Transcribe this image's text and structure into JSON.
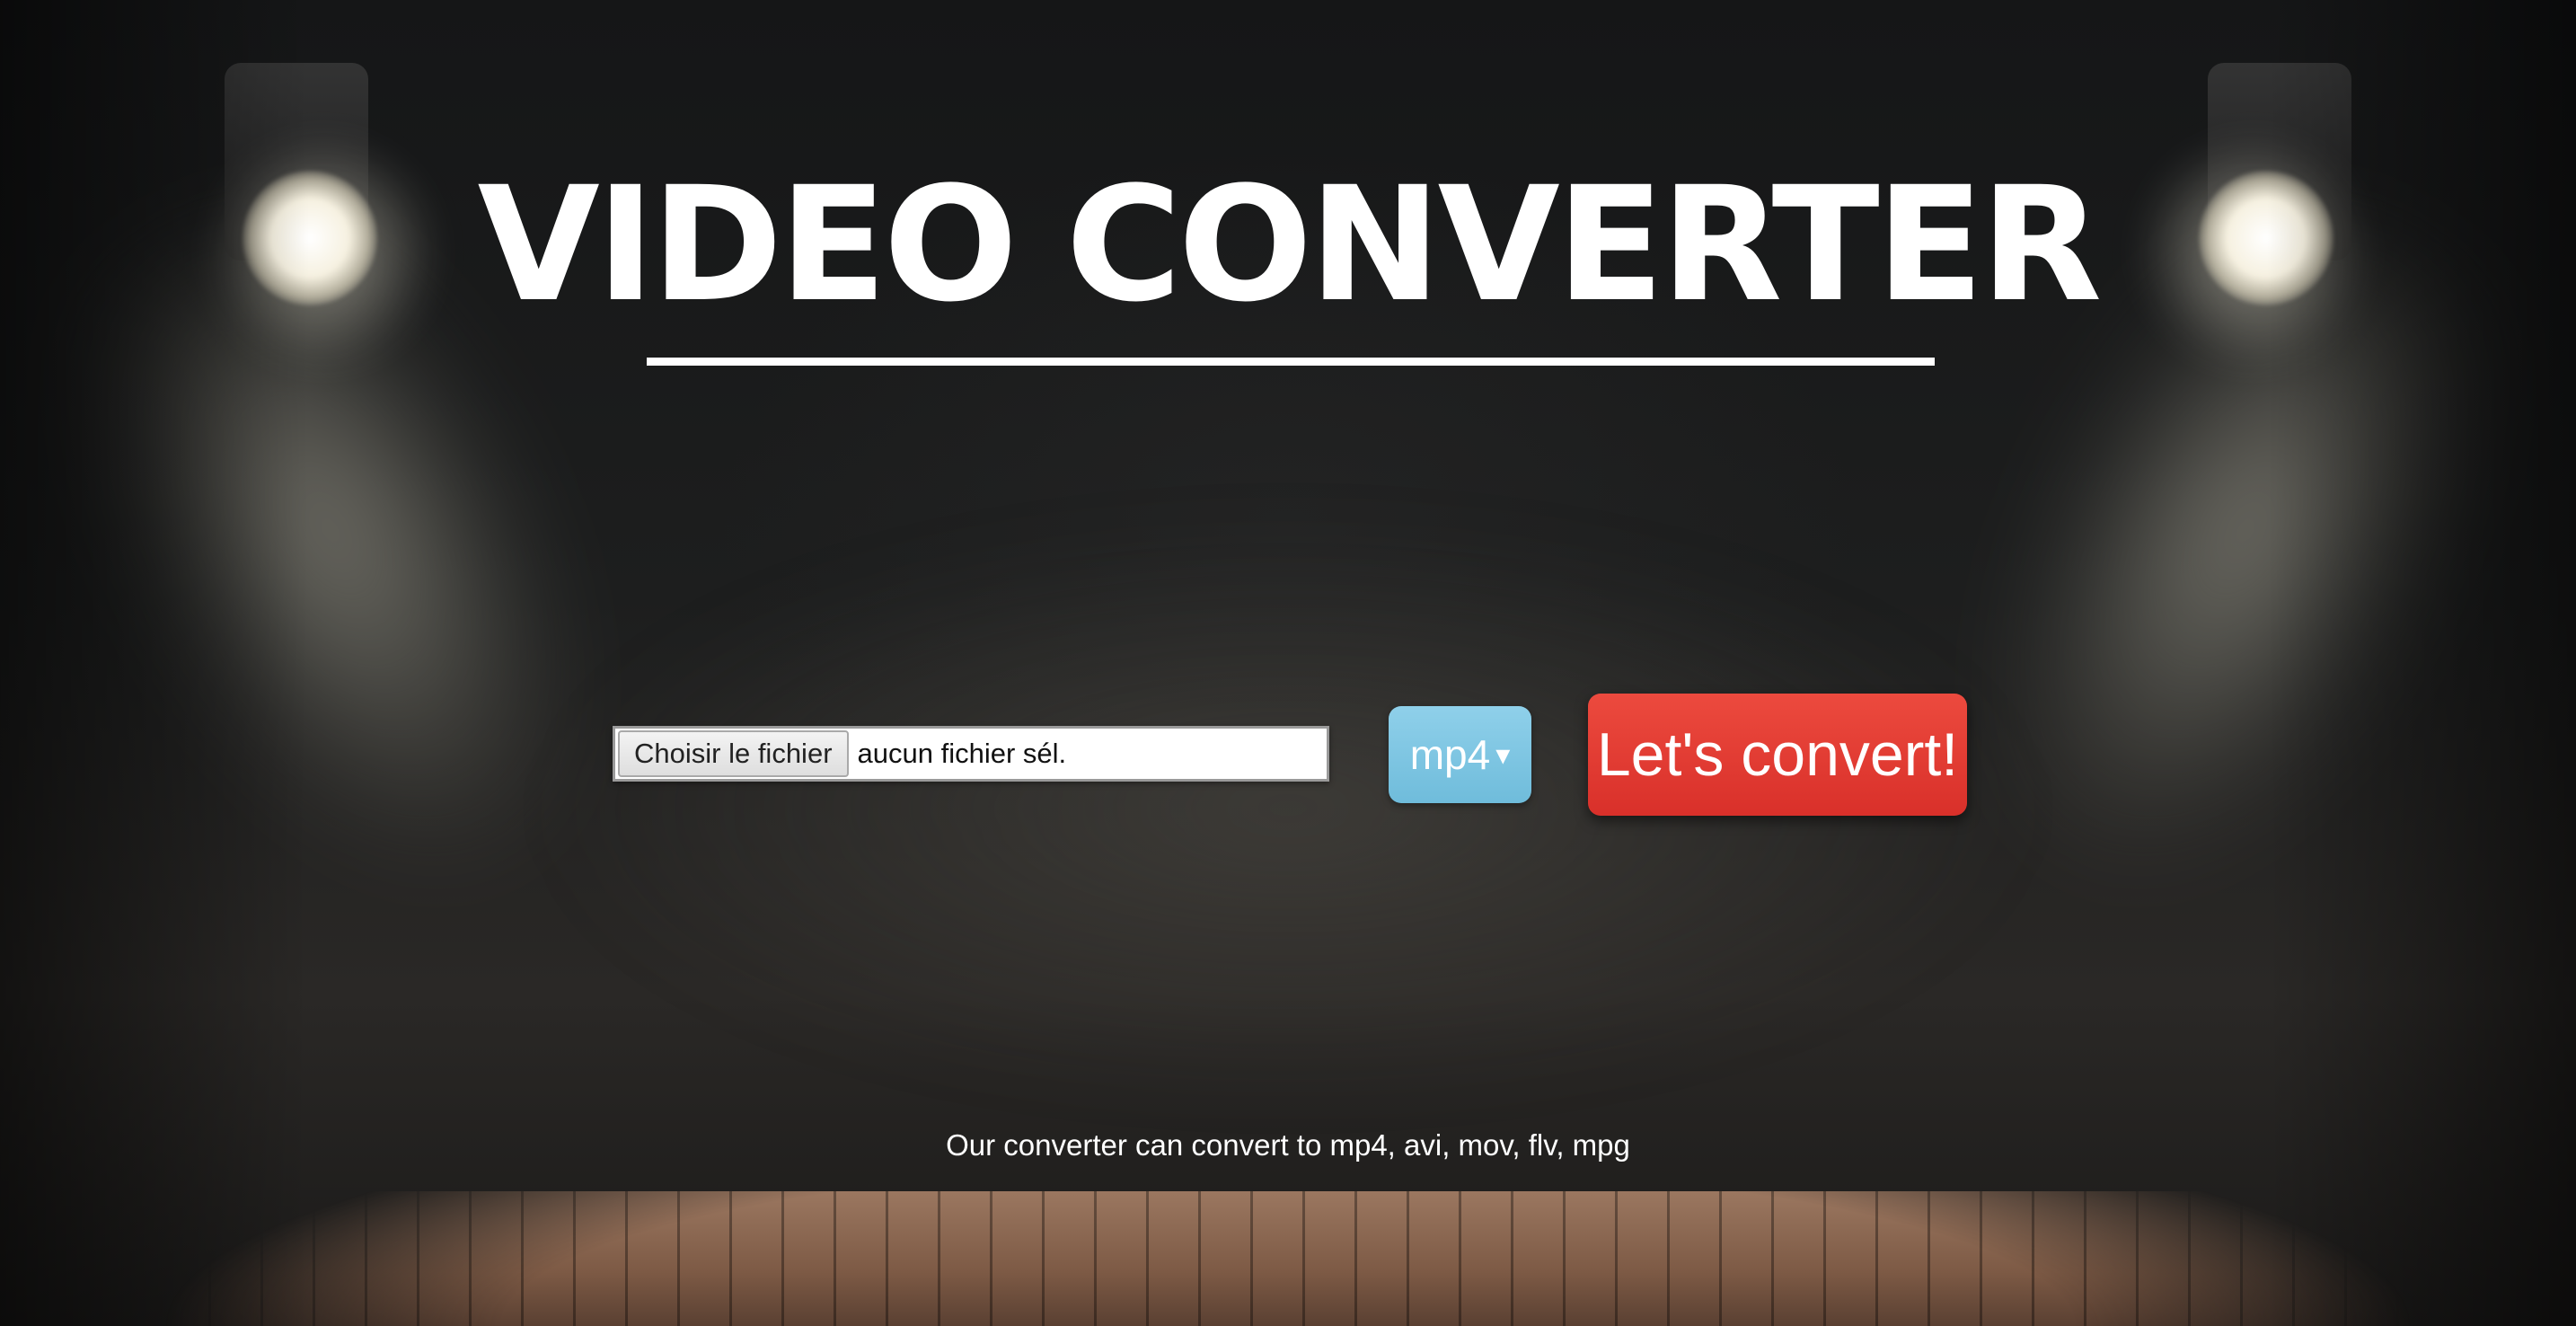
{
  "page": {
    "title": "VIDEO CONVERTER",
    "background_desc": "stage-with-spotlights-and-wooden-floor"
  },
  "upload": {
    "button_label": "Choisir le fichier",
    "file_status": "aucun fichier sél."
  },
  "format_select": {
    "selected": "mp4",
    "arrow_icon": "caret-down-icon",
    "color": "#7cc4e1"
  },
  "convert_button": {
    "label": "Let's convert!",
    "color": "#e23b33"
  },
  "footer": {
    "note": "Our converter can convert to mp4, avi, mov, flv, mpg"
  }
}
